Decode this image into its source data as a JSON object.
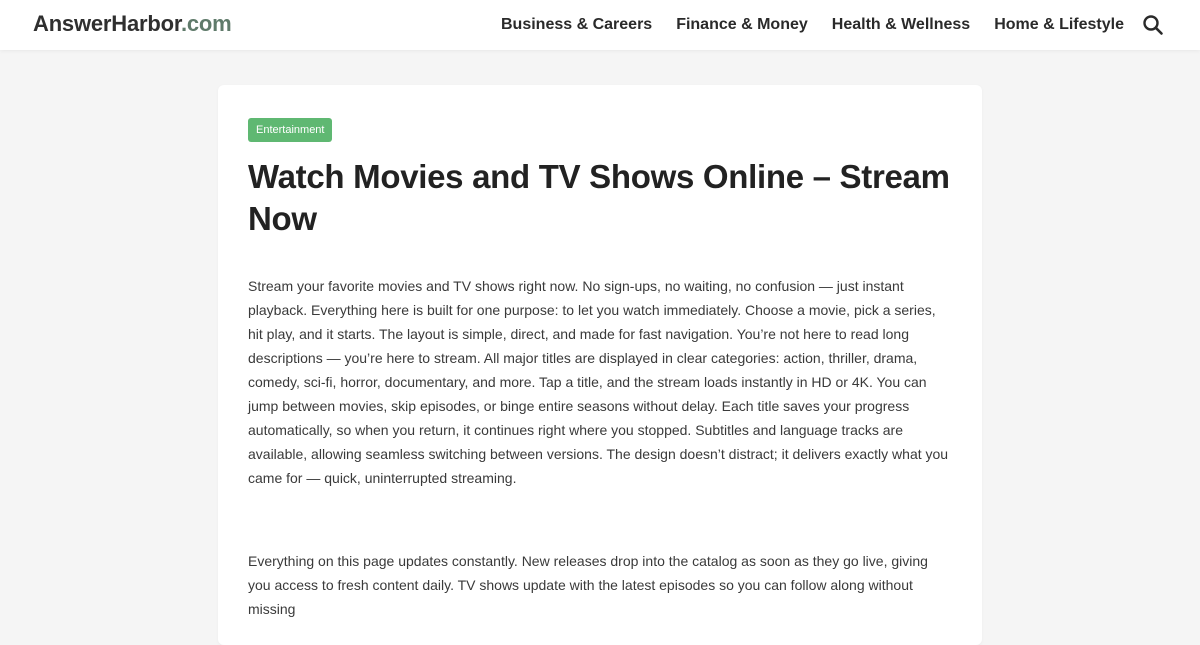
{
  "header": {
    "logo_part1": "AnswerHarbor",
    "logo_part2": ".com",
    "nav": [
      {
        "label": "Business & Careers"
      },
      {
        "label": "Finance & Money"
      },
      {
        "label": "Health & Wellness"
      },
      {
        "label": "Home & Lifestyle"
      }
    ],
    "search_icon": "search-icon"
  },
  "article": {
    "category": "Entertainment",
    "title": "Watch Movies and TV Shows Online – Stream Now",
    "paragraphs": [
      "Stream your favorite movies and TV shows right now. No sign-ups, no waiting, no confusion — just instant playback. Everything here is built for one purpose: to let you watch immediately. Choose a movie, pick a series, hit play, and it starts. The layout is simple, direct, and made for fast navigation. You’re not here to read long descriptions — you’re here to stream. All major titles are displayed in clear categories: action, thriller, drama, comedy, sci-fi, horror, documentary, and more. Tap a title, and the stream loads instantly in HD or 4K. You can jump between movies, skip episodes, or binge entire seasons without delay. Each title saves your progress automatically, so when you return, it continues right where you stopped. Subtitles and language tracks are available, allowing seamless switching between versions. The design doesn’t distract; it delivers exactly what you came for — quick, uninterrupted streaming.",
      "Everything on this page updates constantly. New releases drop into the catalog as soon as they go live, giving you access to fresh content daily. TV shows update with the latest episodes so you can follow along without missing"
    ]
  },
  "colors": {
    "background": "#f5f5f5",
    "card": "#ffffff",
    "badge": "#5fb872",
    "logo_accent": "#5f7a6a",
    "text": "#222222"
  }
}
